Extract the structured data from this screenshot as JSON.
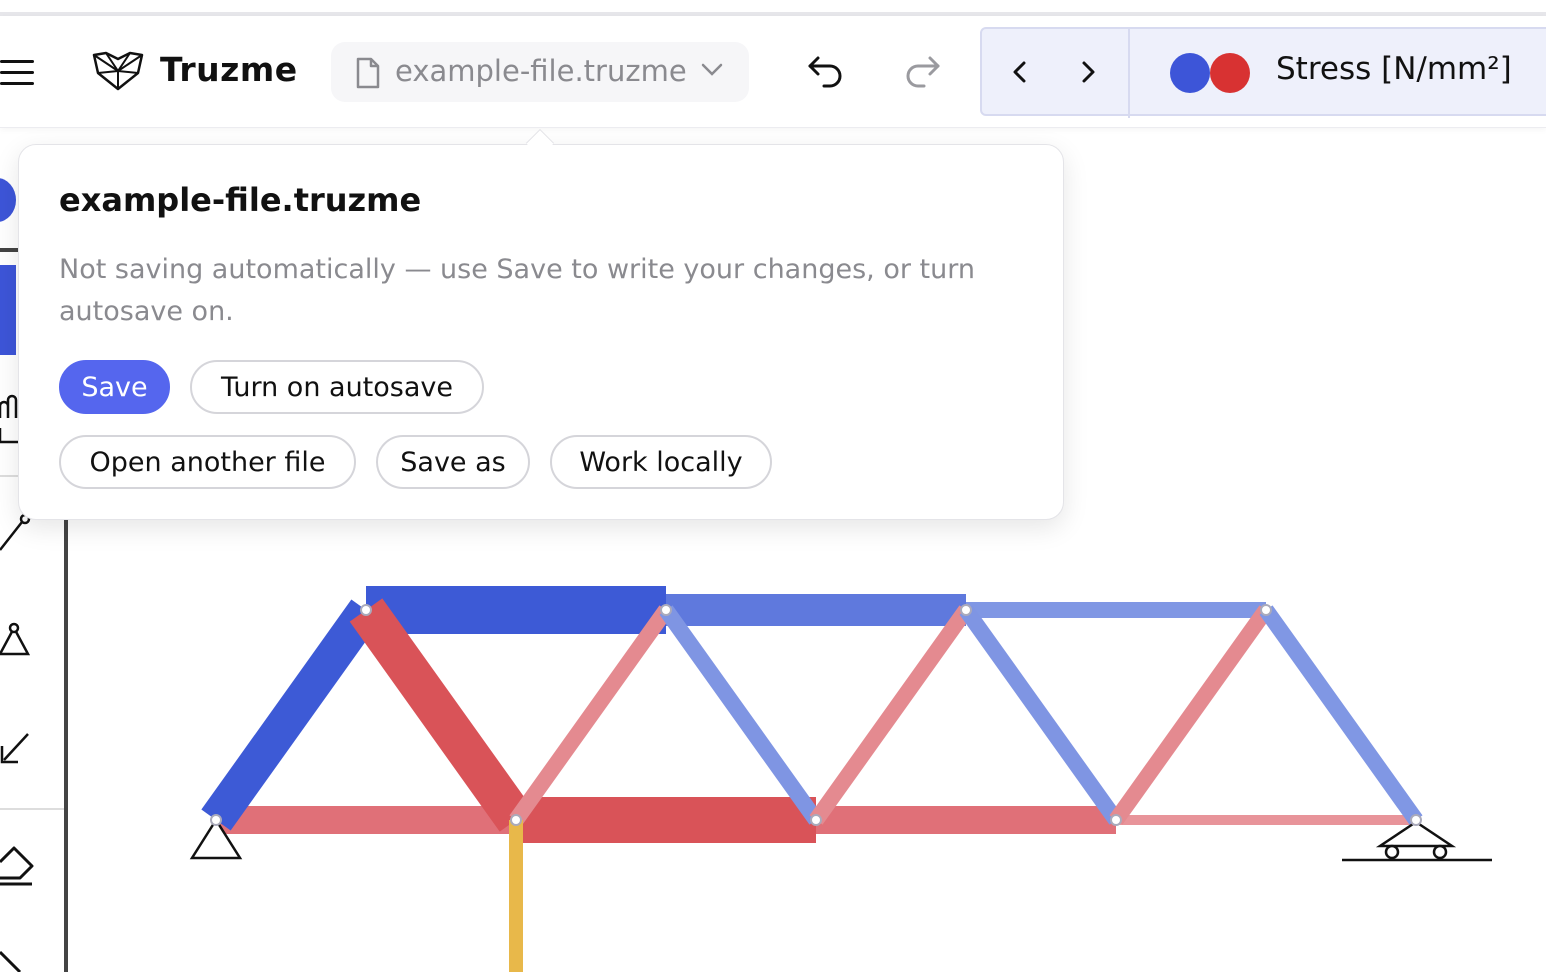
{
  "header": {
    "app_name": "Truzme",
    "file_name": "example-file.truzme",
    "result_label": "Stress [N/mm²]"
  },
  "colors": {
    "compression": "#3d55d8",
    "tension": "#d83232",
    "load": "#e8b84a",
    "accent": "#5566ee"
  },
  "popover": {
    "title": "example-file.truzme",
    "message": "Not saving automatically — use Save to write your changes, or turn autosave on.",
    "actions": {
      "save": "Save",
      "autosave": "Turn on autosave",
      "open": "Open another file",
      "save_as": "Save as",
      "local": "Work locally"
    }
  },
  "icons": {
    "menu": "menu-icon",
    "logo": "truzme-logo-icon",
    "file": "file-icon",
    "chevron": "chevron-down-icon",
    "undo": "undo-icon",
    "redo": "redo-icon",
    "prev": "chevron-left-icon",
    "next": "chevron-right-icon"
  }
}
